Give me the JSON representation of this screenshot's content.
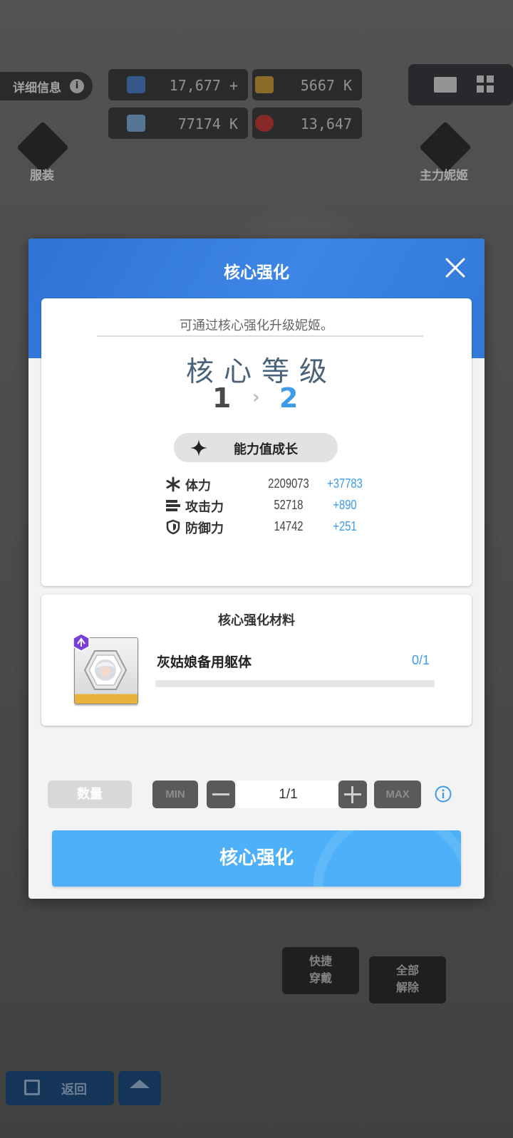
{
  "background": {
    "detail_label": "详细信息",
    "resources": [
      {
        "name": "gem",
        "value": "17,677 +",
        "color": "#4a7fc4"
      },
      {
        "name": "credit",
        "value": "5667 K",
        "color": "#c99a3c"
      },
      {
        "name": "battle-data",
        "value": "77174 K",
        "color": "#7aa9d8"
      },
      {
        "name": "core-dust",
        "value": "13,647",
        "color": "#c23b3b"
      }
    ],
    "costume_label": "服装",
    "main_nikke_label": "主力妮姬",
    "quick_equip_label": "快捷\n穿戴",
    "unequip_all_label": "全部\n解除",
    "back_label": "返回"
  },
  "modal": {
    "title": "核心强化",
    "description": "可通过核心强化升级妮姬。",
    "level_label": "核心等级",
    "level_from": "1",
    "level_to": "2",
    "growth_label": "能力值成长",
    "stats": [
      {
        "icon": "hp-icon",
        "name": "体力",
        "value": "2209073",
        "increase": "+37783"
      },
      {
        "icon": "attack-icon",
        "name": "攻击力",
        "value": "52718",
        "increase": "+890"
      },
      {
        "icon": "defense-icon",
        "name": "防御力",
        "value": "14742",
        "increase": "+251"
      }
    ],
    "materials_title": "核心强化材料",
    "material": {
      "name": "灰姑娘备用躯体",
      "count": "0/1",
      "progress": 0
    },
    "quantity_label": "数量",
    "min_label": "MIN",
    "max_label": "MAX",
    "quantity_value": "1/1",
    "confirm_label": "核心强化"
  },
  "colors": {
    "accent": "#3d9be8",
    "header": "#3079d8",
    "button": "#4db0f8"
  }
}
